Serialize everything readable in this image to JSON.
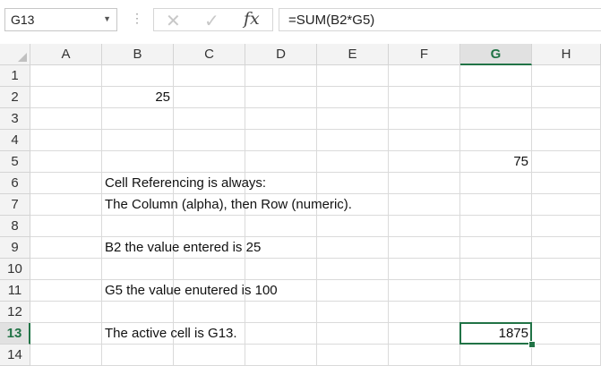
{
  "formula_bar": {
    "name_box": "G13",
    "formula": "=SUM(B2*G5)",
    "cancel_icon": "cancel-icon",
    "enter_icon": "check-icon",
    "fx_label": "fx"
  },
  "grid": {
    "columns": [
      "A",
      "B",
      "C",
      "D",
      "E",
      "F",
      "G",
      "H"
    ],
    "rows": [
      "1",
      "2",
      "3",
      "4",
      "5",
      "6",
      "7",
      "8",
      "9",
      "10",
      "11",
      "12",
      "13",
      "14"
    ],
    "active_column": "G",
    "active_row": "13",
    "cells": {
      "B2": "25",
      "G5": "75",
      "B6": "Cell Referencing is always:",
      "B7": "The Column (alpha), then Row (numeric).",
      "B9": "B2 the value entered is 25",
      "B11": "G5 the value enutered is 100",
      "B13": "The active cell is G13.",
      "G13": "1875"
    }
  },
  "colors": {
    "accent": "#217346",
    "header_bg": "#f3f3f3",
    "gridline": "#dadada"
  }
}
